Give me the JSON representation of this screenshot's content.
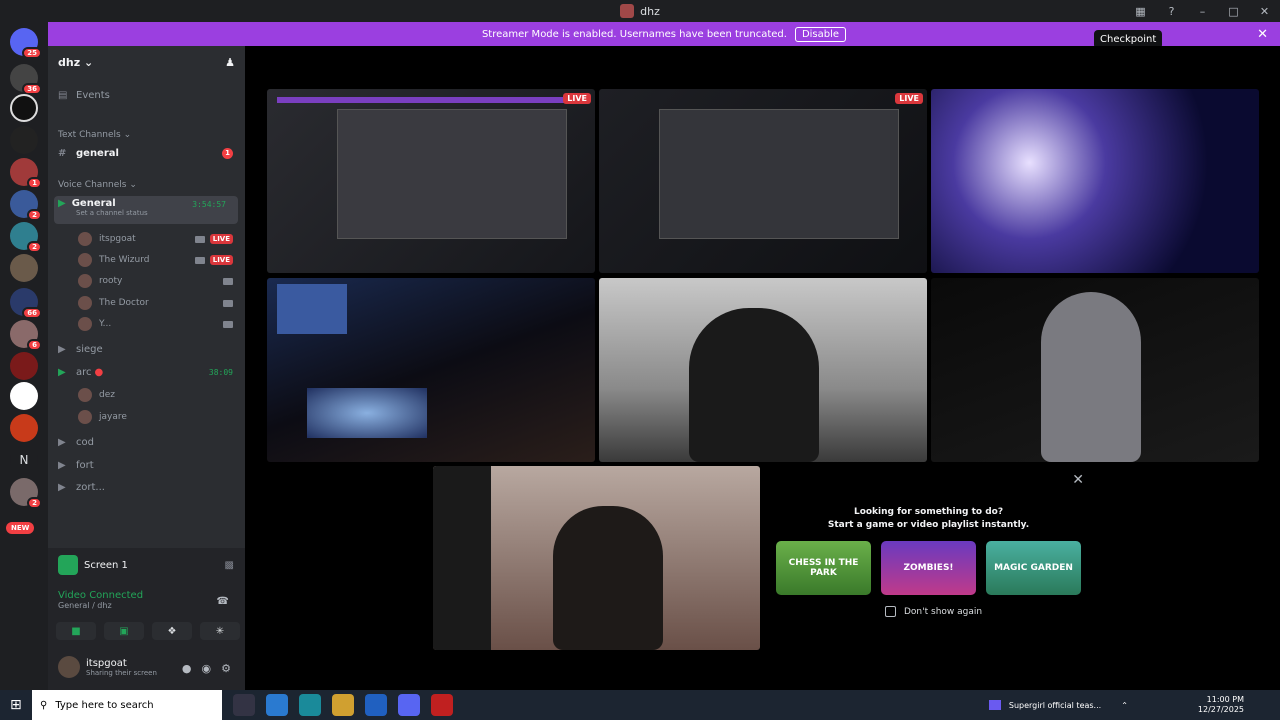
{
  "window": {
    "title": "dhz",
    "checkpoint_tooltip": "Checkpoint"
  },
  "banner": {
    "text": "Streamer Mode is enabled. Usernames have been truncated.",
    "button": "Disable"
  },
  "guild_badges": [
    "25",
    "36",
    "1",
    "2",
    "2",
    "66",
    "6",
    "2"
  ],
  "new_badge": "NEW",
  "guild_n_label": "N",
  "server": {
    "name": "dhz"
  },
  "sidebar": {
    "events": "Events",
    "text_category": "Text Channels",
    "general_text": "general",
    "general_unread": "1",
    "voice_category": "Voice Channels",
    "general_voice": "General",
    "general_timer": "3:54:57",
    "channel_status": "Set a channel status",
    "users": [
      "itspgoat",
      "The Wizurd",
      "rooty",
      "The Doctor",
      "Y..."
    ],
    "live_label": "LIVE",
    "siege": "siege",
    "arc": "arc",
    "arc_timer": "38:09",
    "arc_users": [
      "dez",
      "jayare"
    ],
    "cod": "cod",
    "fort": "fort",
    "zort": "zort..."
  },
  "panel": {
    "screen": "Screen 1",
    "video_connected": "Video Connected",
    "location": "General / dhz",
    "user": "itspgoat",
    "user_status": "Sharing their screen"
  },
  "stage": {
    "live_label": "LIVE",
    "activity_line1": "Looking for something to do?",
    "activity_line2": "Start a game or video playlist instantly.",
    "games": [
      "CHESS IN THE PARK",
      "ZOMBIES!",
      "MAGIC GARDEN"
    ],
    "dont_show": "Don't show again"
  },
  "taskbar": {
    "search_placeholder": "Type here to search",
    "notification": "Supergirl official teas...",
    "time": "11:00 PM",
    "date": "12/27/2025"
  }
}
